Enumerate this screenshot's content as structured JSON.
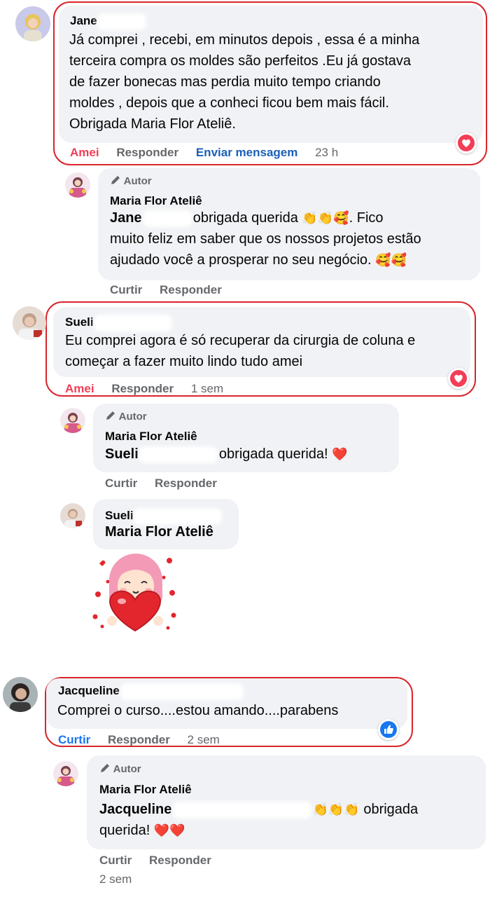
{
  "comments": [
    {
      "author": "Jane",
      "text": "Já comprei , recebi, em minutos depois , essa é a minha terceira compra os moldes são perfeitos .Eu já gostava de fazer bonecas mas perdia muito tempo criando moldes , depois que a conheci ficou bem mais fácil. Obrigada Maria Flor Ateliê.",
      "lines": [
        "Já comprei , recebi, em minutos depois , essa é a minha",
        "terceira compra os moldes são perfeitos .Eu já gostava",
        "de fazer bonecas mas perdia muito tempo criando",
        "moldes , depois que a conheci ficou bem mais fácil.",
        "Obrigada Maria Flor Ateliê."
      ],
      "actions": {
        "react": "Amei",
        "reply": "Responder",
        "message": "Enviar mensagem",
        "time": "23 h"
      },
      "reaction_icon": "heart-icon"
    },
    {
      "author": "Sueli",
      "lines": [
        "Eu comprei agora é só recuperar da cirurgia de coluna e",
        "começar a fazer muito lindo tudo amei"
      ],
      "actions": {
        "react": "Amei",
        "reply": "Responder",
        "time": "1 sem"
      },
      "reaction_icon": "heart-icon"
    },
    {
      "author": "Jacqueline",
      "lines": [
        "Comprei o curso....estou amando....parabens"
      ],
      "actions": {
        "react": "Curtir",
        "reply": "Responder",
        "time": "2 sem"
      },
      "reaction_icon": "thumbs-up-icon"
    }
  ],
  "replies": [
    {
      "badge": "Autor",
      "author": "Maria Flor Ateliê",
      "mention": "Jane",
      "text1": "obrigada querida",
      "text1_tail": ". Fico",
      "lines": [
        "muito feliz em saber que os nossos projetos estão",
        "ajudado você a prosperar no seu negócio."
      ],
      "emoji_clap": "👏👏🥰",
      "emoji_end": "🥰🥰",
      "actions": {
        "like": "Curtir",
        "reply": "Responder"
      }
    },
    {
      "badge": "Autor",
      "author": "Maria Flor Ateliê",
      "mention": "Sueli",
      "text": "obrigada querida!",
      "emoji": "❤️",
      "actions": {
        "like": "Curtir",
        "reply": "Responder"
      }
    },
    {
      "author": "Sueli",
      "mention": "Maria Flor Ateliê"
    },
    {
      "badge": "Autor",
      "author": "Maria Flor Ateliê",
      "mention": "Jacqueline",
      "emoji_clap": "👏👏👏",
      "text": "obrigada",
      "line2": "querida!",
      "emoji": "❤️❤️",
      "actions": {
        "like": "Curtir",
        "reply": "Responder"
      },
      "time": "2 sem"
    }
  ],
  "colors": {
    "bubble": "#f0f2f5",
    "frame": "#d9252c",
    "love": "#f33e58",
    "like": "#1877f2",
    "muted": "#65676b"
  }
}
